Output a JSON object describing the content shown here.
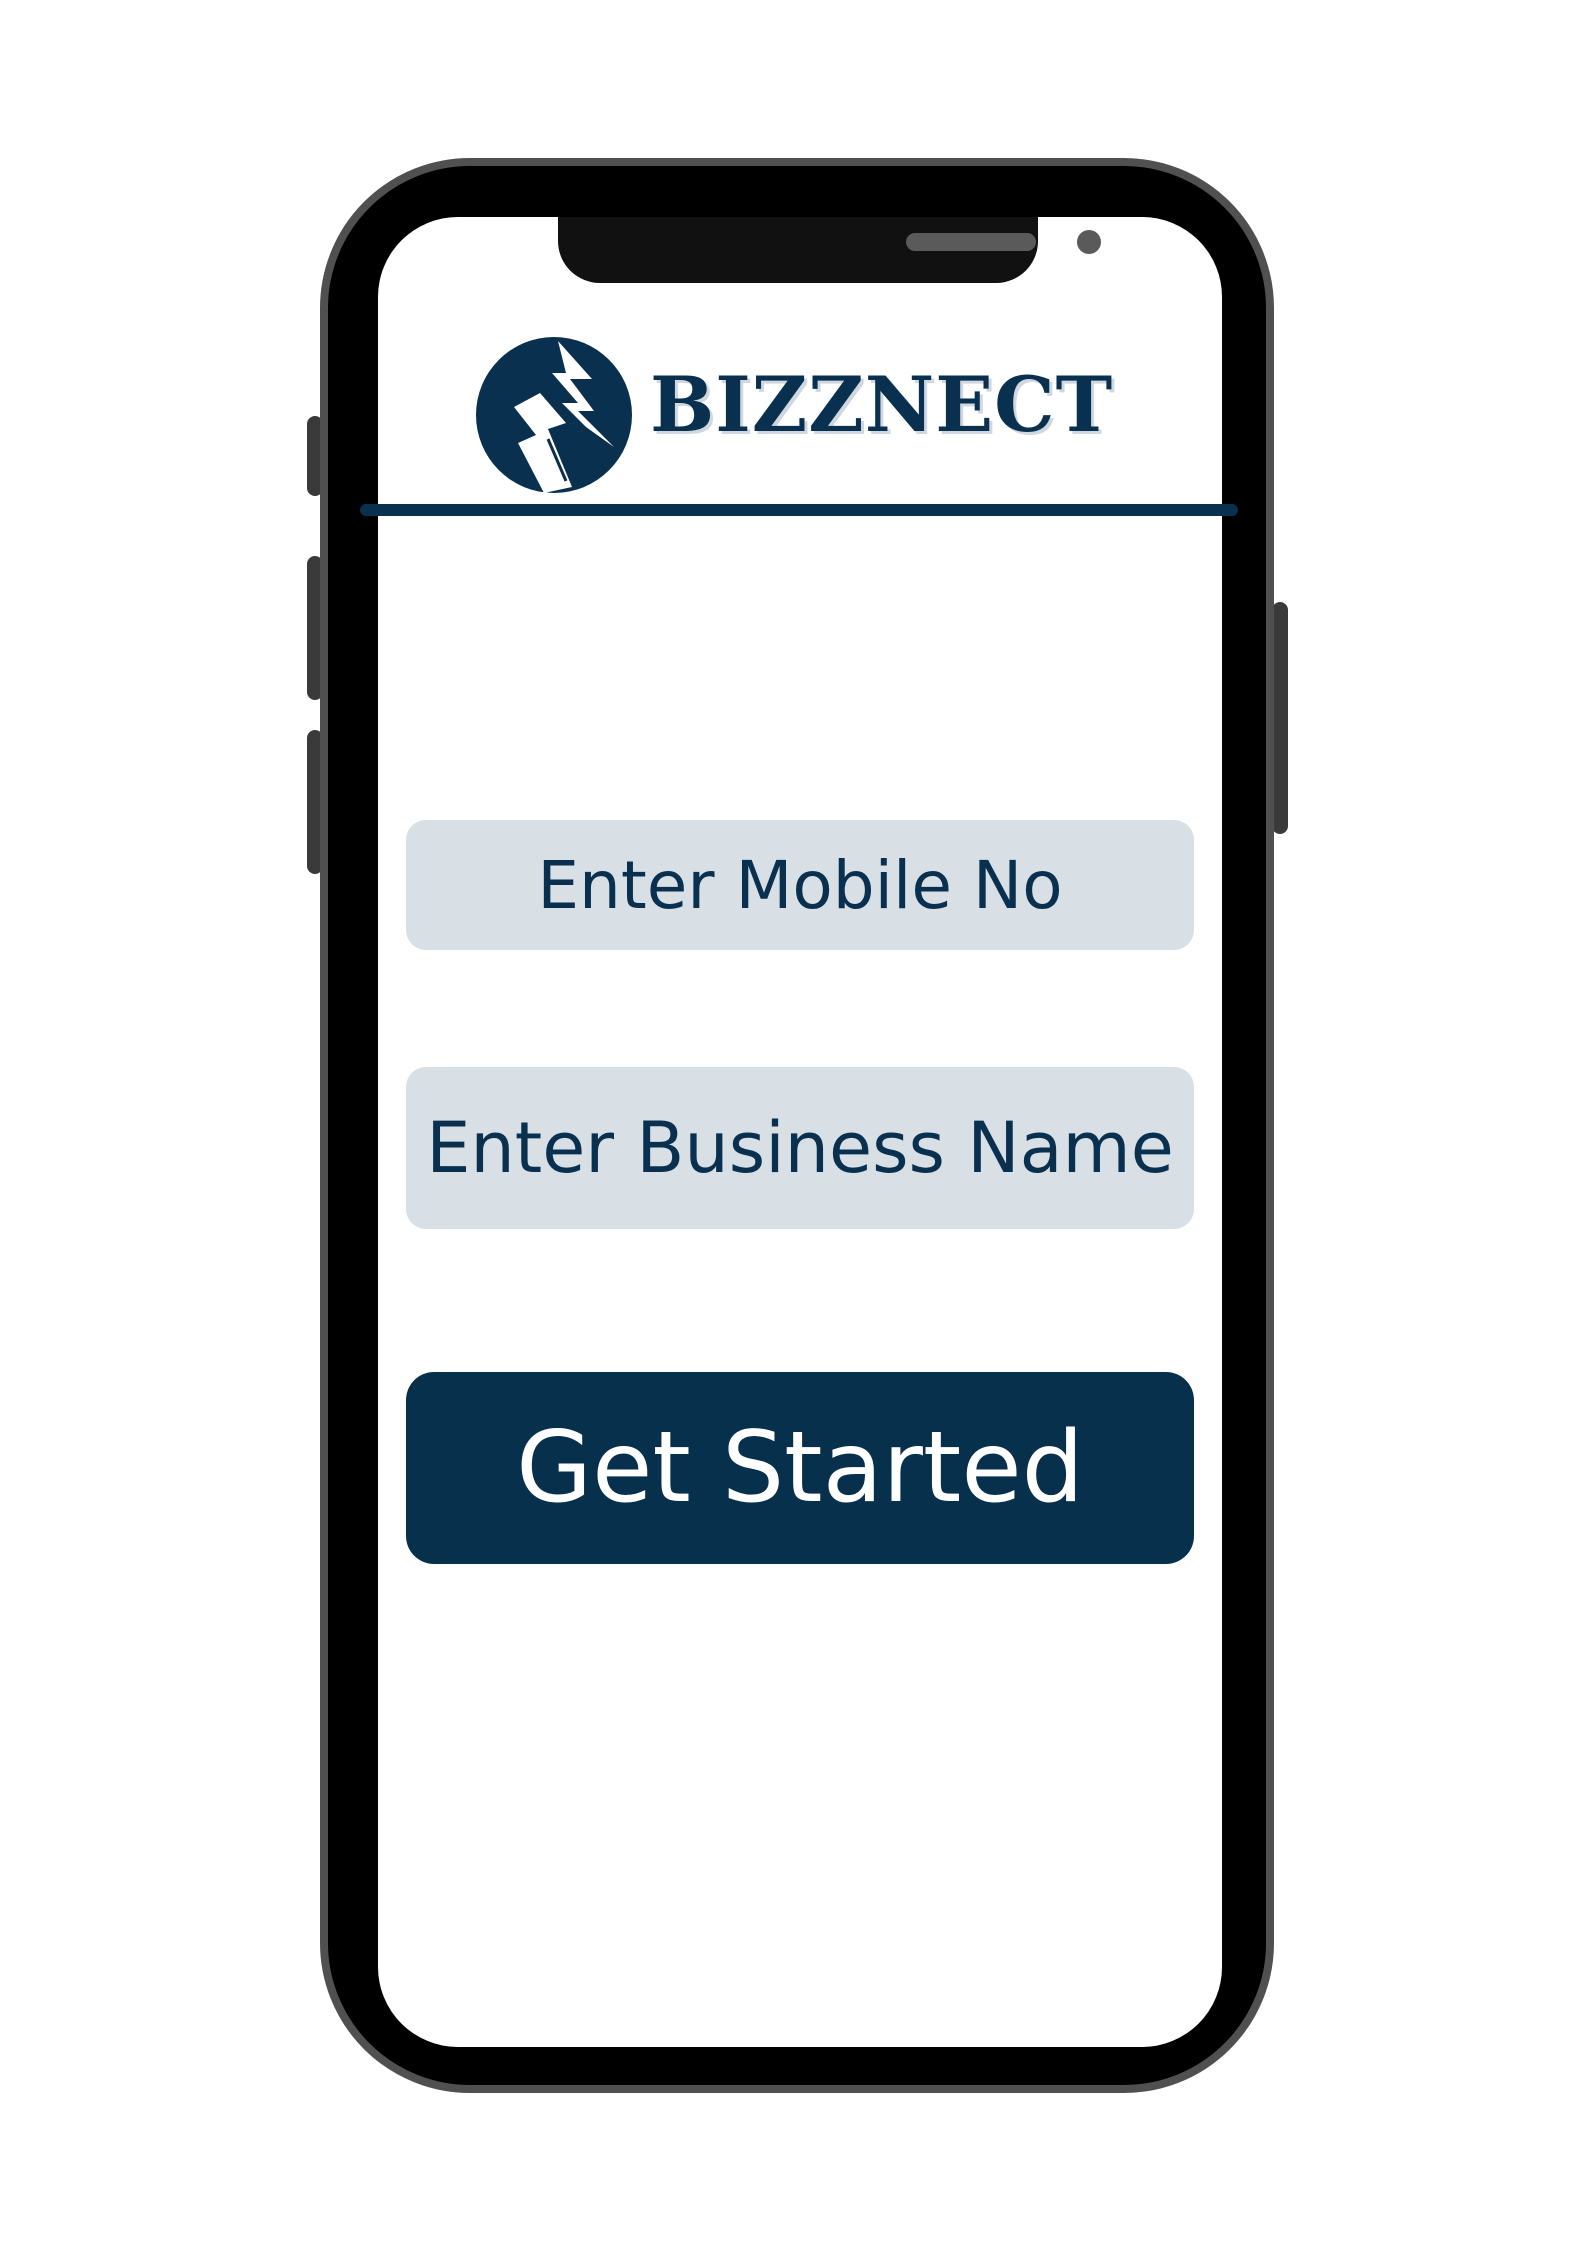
{
  "app": {
    "brand_name": "BIZZNECT",
    "logo_icon": "bizznect-arrow-logo-icon"
  },
  "form": {
    "mobile_placeholder": "Enter Mobile No",
    "business_placeholder": "Enter Business Name",
    "submit_label": "Get Started"
  },
  "colors": {
    "brand_navy": "#0a3050",
    "button_navy": "#07304d",
    "input_background": "#d8dfe5",
    "screen_background": "#ffffff",
    "phone_bezel": "#000000",
    "phone_frame": "#505050"
  }
}
